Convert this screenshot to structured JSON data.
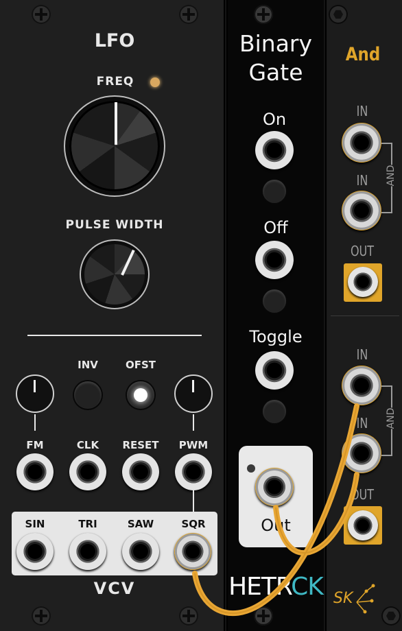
{
  "lfo": {
    "title": "LFO",
    "freq_label": "FREQ",
    "pulse_width_label": "PULSE WIDTH",
    "inv_label": "INV",
    "ofst_label": "OFST",
    "inputs": [
      "FM",
      "CLK",
      "RESET",
      "PWM"
    ],
    "outputs": [
      "SIN",
      "TRI",
      "SAW",
      "SQR"
    ],
    "brand": "VCV"
  },
  "binary_gate": {
    "title_line1": "Binary",
    "title_line2": "Gate",
    "on_label": "On",
    "off_label": "Off",
    "toggle_label": "Toggle",
    "out_label": "Out",
    "brand_part1": "HETR",
    "brand_part2": "CK",
    "colors": {
      "brand_accent": "#3fb8c4"
    }
  },
  "and_module": {
    "title": "And",
    "in_label": "IN",
    "out_label": "OUT",
    "and_tag": "AND",
    "brand": "SK",
    "colors": {
      "accent": "#e0a52a"
    }
  },
  "icons": [
    "screw-icon",
    "hex-screw-icon",
    "led-icon",
    "sk-logo-icon"
  ],
  "colors": {
    "cable": "#e8a634",
    "panel": "#1f1f1f"
  }
}
